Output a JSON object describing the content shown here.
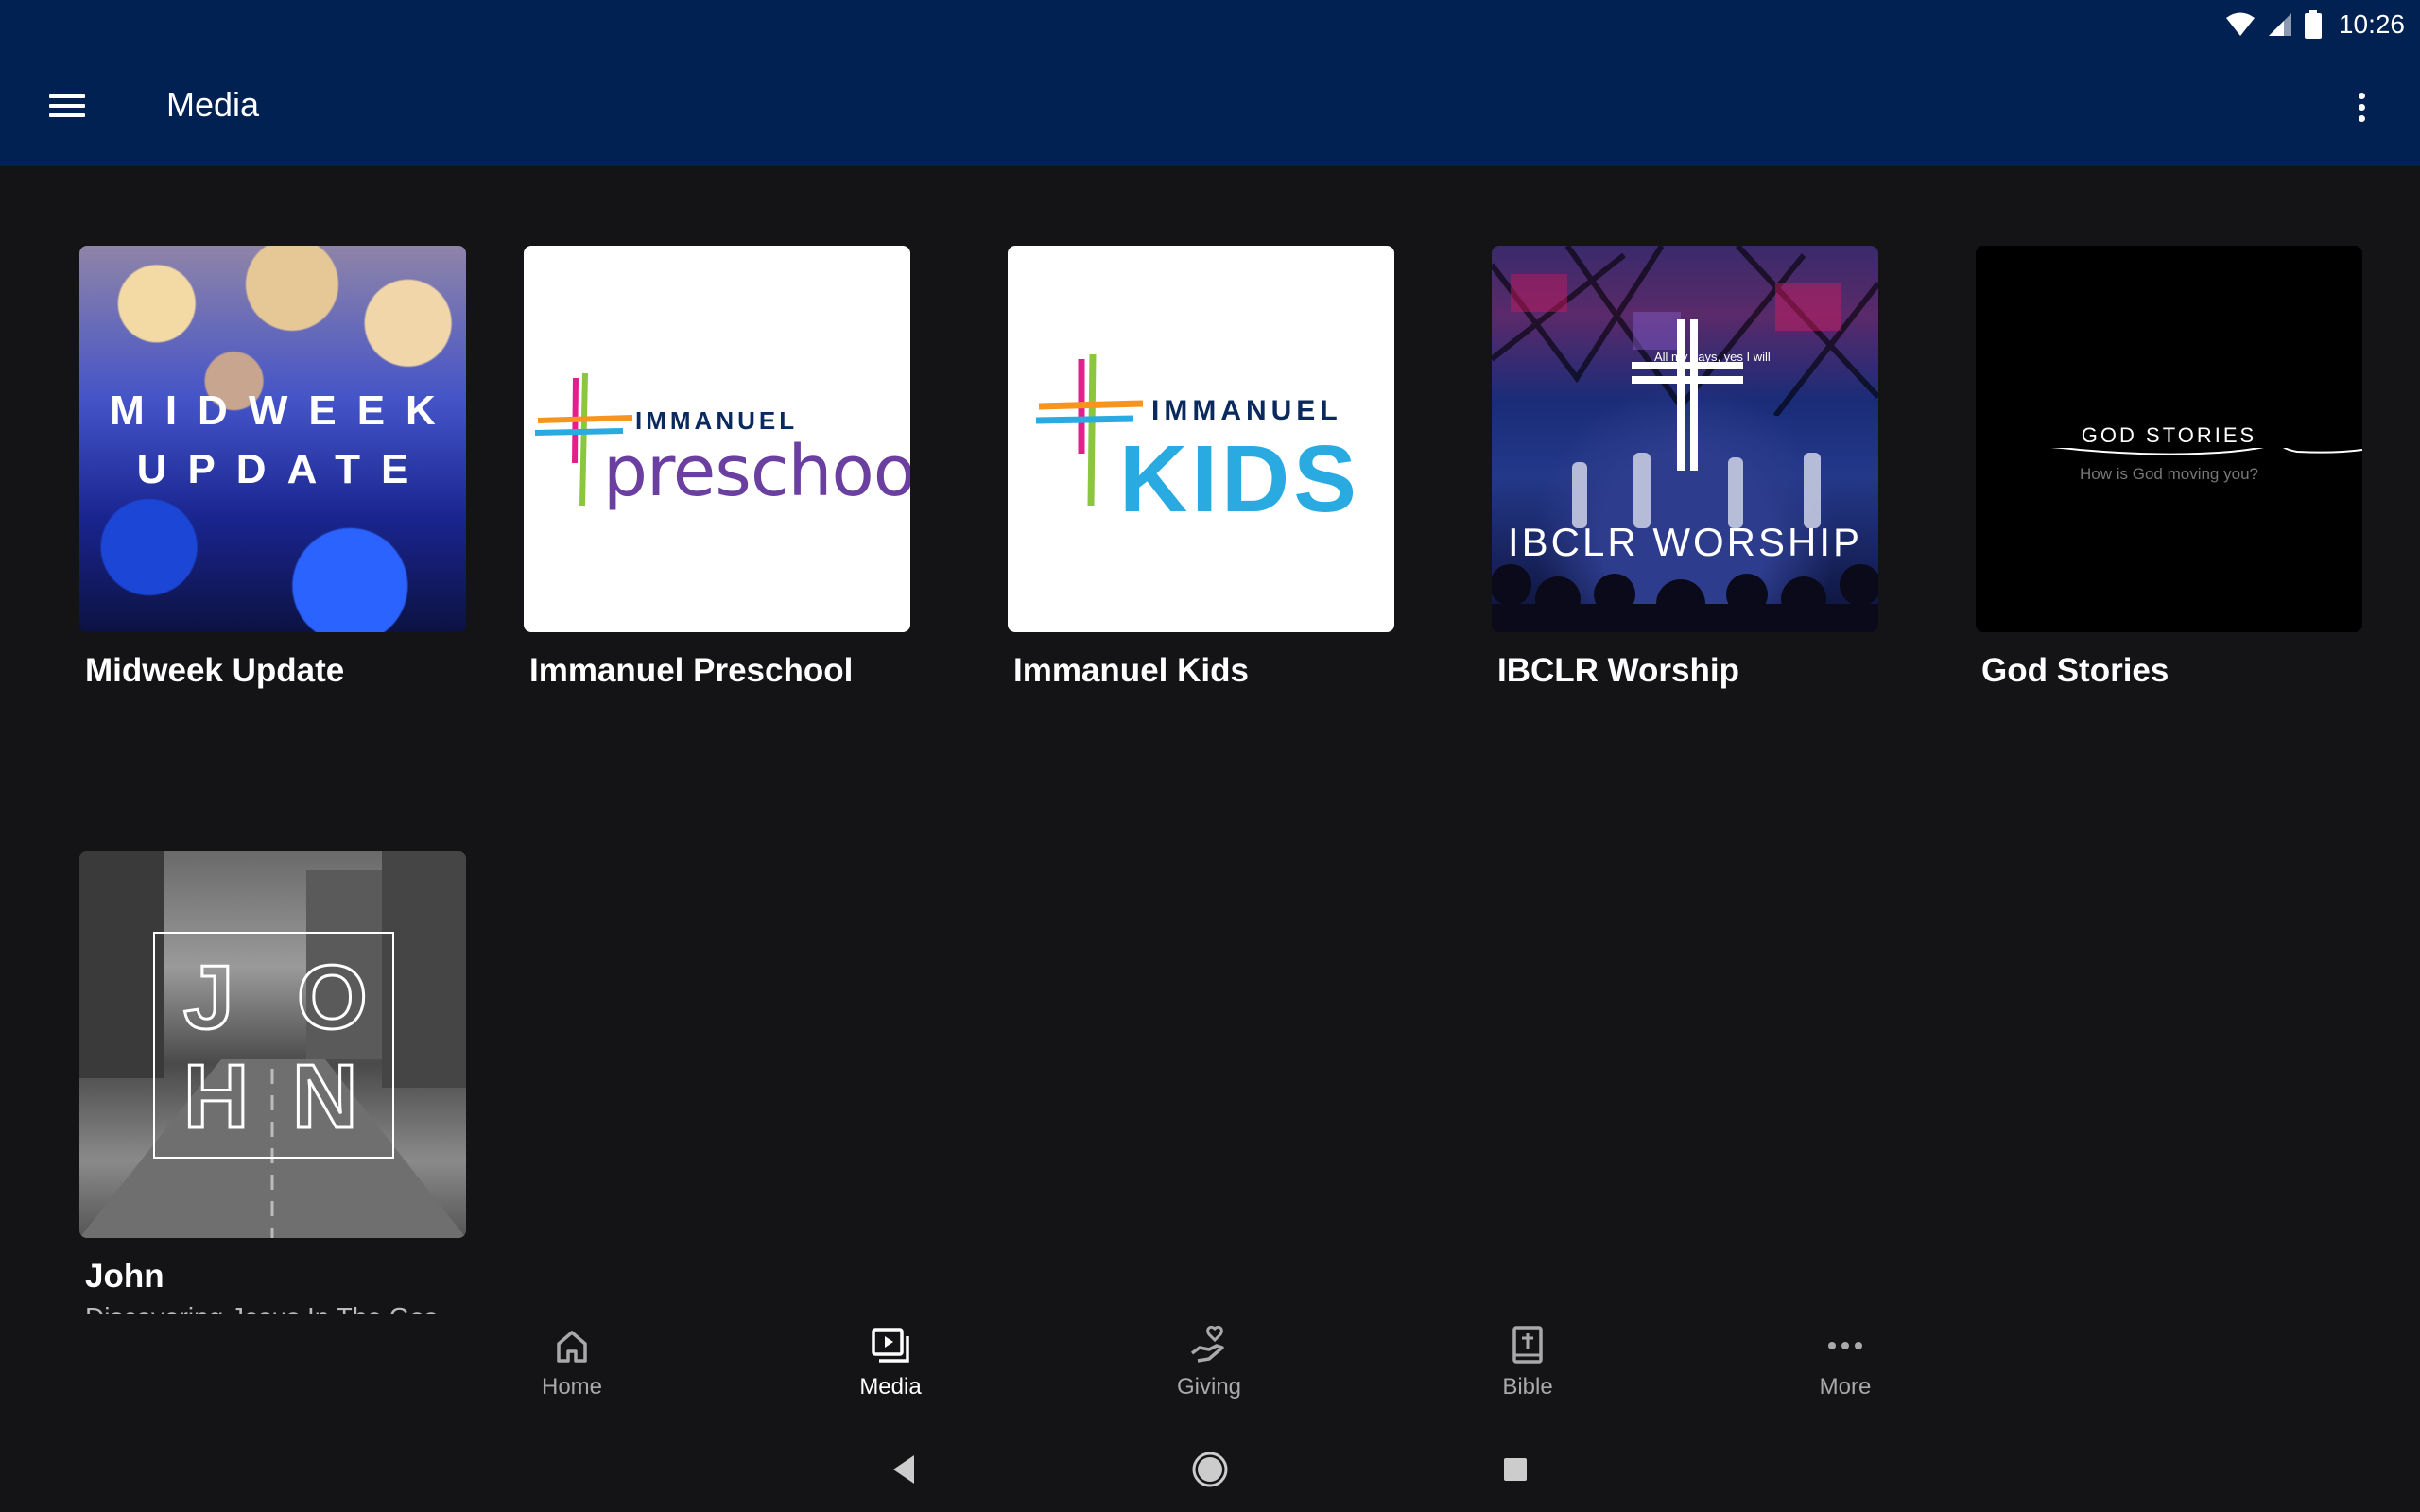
{
  "status_bar": {
    "time": "10:26"
  },
  "app_bar": {
    "title": "Media"
  },
  "media_tiles": [
    {
      "title": "Midweek Update",
      "art_lines": [
        "MIDWEEK",
        "UPDATE"
      ]
    },
    {
      "title": "Immanuel Preschool",
      "art_top": "IMMANUEL",
      "art_main": "preschool"
    },
    {
      "title": "Immanuel Kids",
      "art_top": "IMMANUEL",
      "art_main": "KIDS"
    },
    {
      "title": "IBCLR Worship",
      "art_caption": "All my days, yes I will",
      "art_main": "IBCLR WORSHIP"
    },
    {
      "title": "God Stories",
      "art_main": "GOD STORIES",
      "art_sub": "How is God moving you?"
    },
    {
      "title": "John",
      "subtitle": "Discovering Jesus In The Gos...",
      "art_letters": [
        "J",
        "O",
        "H",
        "N"
      ]
    }
  ],
  "bottom_nav": [
    {
      "label": "Home",
      "icon": "home-icon"
    },
    {
      "label": "Media",
      "icon": "media-icon",
      "active": true
    },
    {
      "label": "Giving",
      "icon": "giving-icon"
    },
    {
      "label": "Bible",
      "icon": "bible-icon"
    },
    {
      "label": "More",
      "icon": "more-icon"
    }
  ],
  "colors": {
    "app_bar": "#012152",
    "background": "#141416",
    "active_nav": "#ffffff",
    "inactive_nav": "#a9a9a9"
  }
}
